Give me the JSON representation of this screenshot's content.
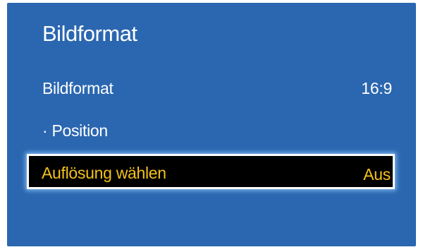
{
  "menu": {
    "title": "Bildformat",
    "items": [
      {
        "label": "Bildformat",
        "value": "16:9"
      },
      {
        "label": "· Position",
        "value": ""
      },
      {
        "label": "Auflösung wählen",
        "value": "Aus",
        "selected": true
      }
    ]
  },
  "colors": {
    "panel_background": "#2b67b0",
    "text": "#ffffff",
    "selected_background": "#000000",
    "selected_text": "#f4c21a",
    "selected_border": "#ffffff"
  }
}
